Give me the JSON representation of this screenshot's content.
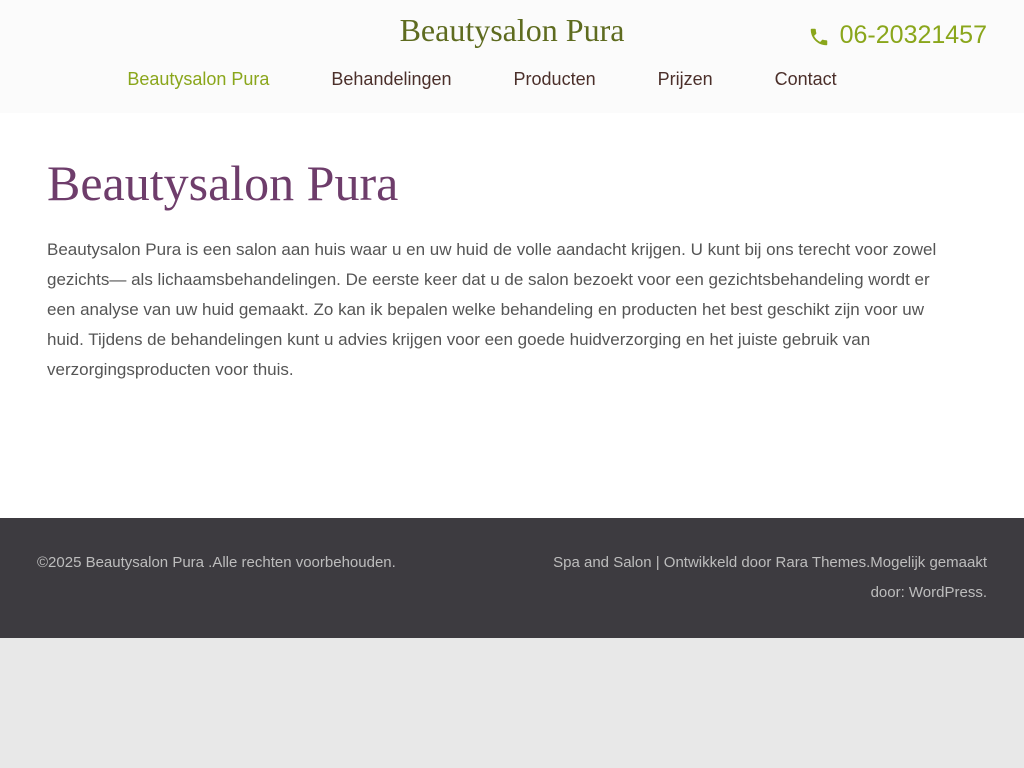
{
  "header": {
    "site_title": "Beautysalon Pura",
    "phone": "06-20321457",
    "phone_icon": "phone-icon",
    "accent_color": "#8aa61b"
  },
  "nav": {
    "items": [
      {
        "label": "Beautysalon Pura",
        "active": true
      },
      {
        "label": "Behandelingen",
        "active": false
      },
      {
        "label": "Producten",
        "active": false
      },
      {
        "label": "Prijzen",
        "active": false
      },
      {
        "label": "Contact",
        "active": false
      }
    ]
  },
  "main": {
    "title": "Beautysalon Pura",
    "intro": "Beautysalon Pura is een salon aan huis waar u en uw huid de volle aandacht krijgen. U kunt bij ons terecht voor zowel gezichts— als lichaamsbehandelingen. De eerste keer dat u de salon bezoekt voor een gezichtsbehandeling wordt er een analyse van uw huid gemaakt. Zo kan ik bepalen welke behandeling en producten het best geschikt zijn voor uw huid. Tijdens de behandelingen kunt u advies krijgen voor een goede huidverzorging en het juiste gebruik van verzorgingsproducten voor thuis."
  },
  "footer": {
    "copyright": "©2025 Beautysalon Pura .Alle rechten voorbehouden.",
    "credit_theme": "Spa and Salon",
    "credit_separator": " | ",
    "credit_dev": "Ontwikkeld door Rara Themes.",
    "credit_powered": "Mogelijk gemaakt door: ",
    "credit_wp": "WordPress."
  }
}
